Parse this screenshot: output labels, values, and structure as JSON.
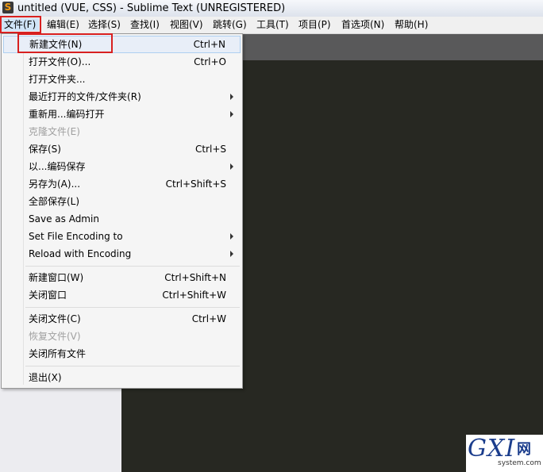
{
  "window": {
    "title": "untitled (VUE, CSS) - Sublime Text (UNREGISTERED)"
  },
  "menubar": [
    {
      "label": "文件(F)"
    },
    {
      "label": "编辑(E)"
    },
    {
      "label": "选择(S)"
    },
    {
      "label": "查找(I)"
    },
    {
      "label": "视图(V)"
    },
    {
      "label": "跳转(G)"
    },
    {
      "label": "工具(T)"
    },
    {
      "label": "项目(P)"
    },
    {
      "label": "首选项(N)"
    },
    {
      "label": "帮助(H)"
    }
  ],
  "file_menu": {
    "items": [
      {
        "label": "新建文件(N)",
        "shortcut": "Ctrl+N"
      },
      {
        "label": "打开文件(O)...",
        "shortcut": "Ctrl+O"
      },
      {
        "label": "打开文件夹...",
        "shortcut": ""
      },
      {
        "label": "最近打开的文件/文件夹(R)",
        "shortcut": ""
      },
      {
        "label": "重新用...编码打开",
        "shortcut": ""
      },
      {
        "label": "克隆文件(E)",
        "shortcut": ""
      },
      {
        "label": "保存(S)",
        "shortcut": "Ctrl+S"
      },
      {
        "label": "以...编码保存",
        "shortcut": ""
      },
      {
        "label": "另存为(A)...",
        "shortcut": "Ctrl+Shift+S"
      },
      {
        "label": "全部保存(L)",
        "shortcut": ""
      },
      {
        "label": "Save as Admin",
        "shortcut": ""
      },
      {
        "label": "Set File Encoding to",
        "shortcut": ""
      },
      {
        "label": "Reload with Encoding",
        "shortcut": ""
      },
      {
        "label": "新建窗口(W)",
        "shortcut": "Ctrl+Shift+N"
      },
      {
        "label": "关闭窗口",
        "shortcut": "Ctrl+Shift+W"
      },
      {
        "label": "关闭文件(C)",
        "shortcut": "Ctrl+W"
      },
      {
        "label": "恢复文件(V)",
        "shortcut": ""
      },
      {
        "label": "关闭所有文件",
        "shortcut": ""
      },
      {
        "label": "退出(X)",
        "shortcut": ""
      }
    ]
  },
  "watermark": {
    "big": "GXI",
    "cn": "网",
    "sub": "system.com"
  },
  "colors": {
    "editor_bg": "#272822",
    "highlight_box": "#d82020"
  }
}
